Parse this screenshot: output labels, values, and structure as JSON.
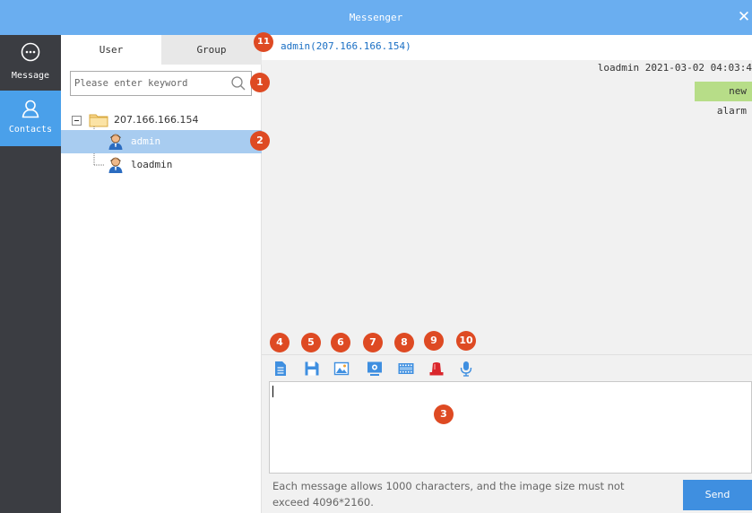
{
  "window": {
    "title": "Messenger",
    "close_glyph": "✕"
  },
  "nav": {
    "items": [
      {
        "label": "Message",
        "icon": "chat-bubble-icon",
        "active": false
      },
      {
        "label": "Contacts",
        "icon": "contact-person-icon",
        "active": true
      }
    ]
  },
  "tabs": {
    "user": "User",
    "group": "Group"
  },
  "search": {
    "placeholder": "Please enter keyword",
    "value": ""
  },
  "tree": {
    "server": {
      "label": "207.166.166.154",
      "expander": "⊟"
    },
    "users": [
      {
        "label": "admin",
        "selected": true
      },
      {
        "label": "loadmin",
        "selected": false
      }
    ]
  },
  "chat": {
    "contact": "admin(207.166.166.154)",
    "messages": [
      {
        "sender": "loadmin",
        "timestamp": "2021-03-02 04:03:4",
        "text": "new alarm"
      }
    ]
  },
  "toolbar": {
    "tools": [
      {
        "name": "file-icon",
        "color": "#3f8fe0"
      },
      {
        "name": "save-icon",
        "color": "#3f8fe0"
      },
      {
        "name": "image-icon",
        "color": "#3f8fe0"
      },
      {
        "name": "screenshot-icon",
        "color": "#3f8fe0"
      },
      {
        "name": "video-clip-icon",
        "color": "#3f8fe0"
      },
      {
        "name": "alarm-light-icon",
        "color": "#d9262c"
      },
      {
        "name": "microphone-icon",
        "color": "#3f8fe0"
      }
    ]
  },
  "compose": {
    "value": "",
    "hint": "Each message allows 1000 characters, and the image size must not exceed 4096*2160.",
    "send_label": "Send"
  },
  "callouts": [
    "1",
    "2",
    "3",
    "4",
    "5",
    "6",
    "7",
    "8",
    "9",
    "10",
    "11"
  ],
  "colors": {
    "titlebar": "#6aaef0",
    "nav_background": "#3b3d42",
    "nav_active": "#4aa0ea",
    "selected_row": "#a8ccf0",
    "callout": "#de4a23",
    "alarm_bubble": "#b7dd88",
    "send_button": "#3f8fe0"
  }
}
